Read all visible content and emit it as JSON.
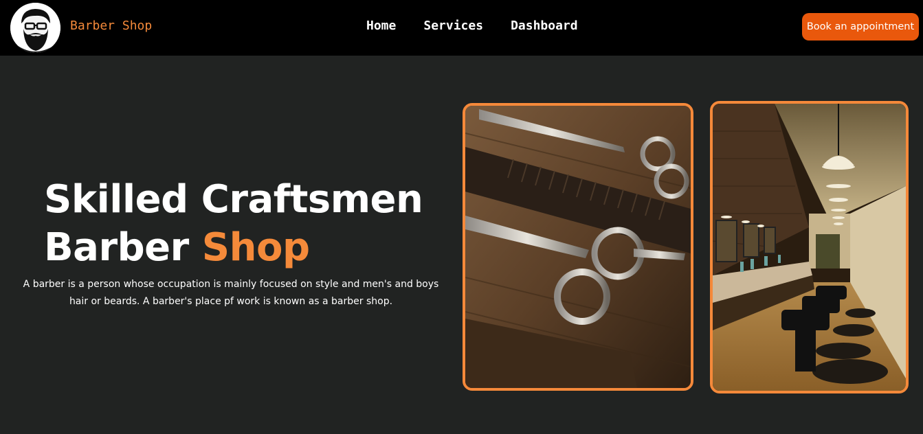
{
  "navbar": {
    "logo_icon": "bearded-barber-logo-icon",
    "brand_name": "Barber Shop",
    "links": [
      {
        "label": "Home"
      },
      {
        "label": "Services"
      },
      {
        "label": "Dashboard"
      }
    ],
    "cta_label": "Book an appointment"
  },
  "hero": {
    "title_line1": "Skilled Craftsmen",
    "title_line2_main": "Barber ",
    "title_line2_accent": "Shop",
    "description": "A barber is a person whose occupation is mainly focused on style and men's and boys hair or beards. A barber's place pf work is known as a barber shop."
  },
  "images": [
    {
      "subject": "scissors-and-comb-on-wood-photo"
    },
    {
      "subject": "barbershop-interior-chairs-photo"
    }
  ],
  "colors": {
    "background": "#212322",
    "navbar": "#000000",
    "accent": "#f58a3a",
    "cta": "#e9580c",
    "card_border": "#f5893a"
  }
}
